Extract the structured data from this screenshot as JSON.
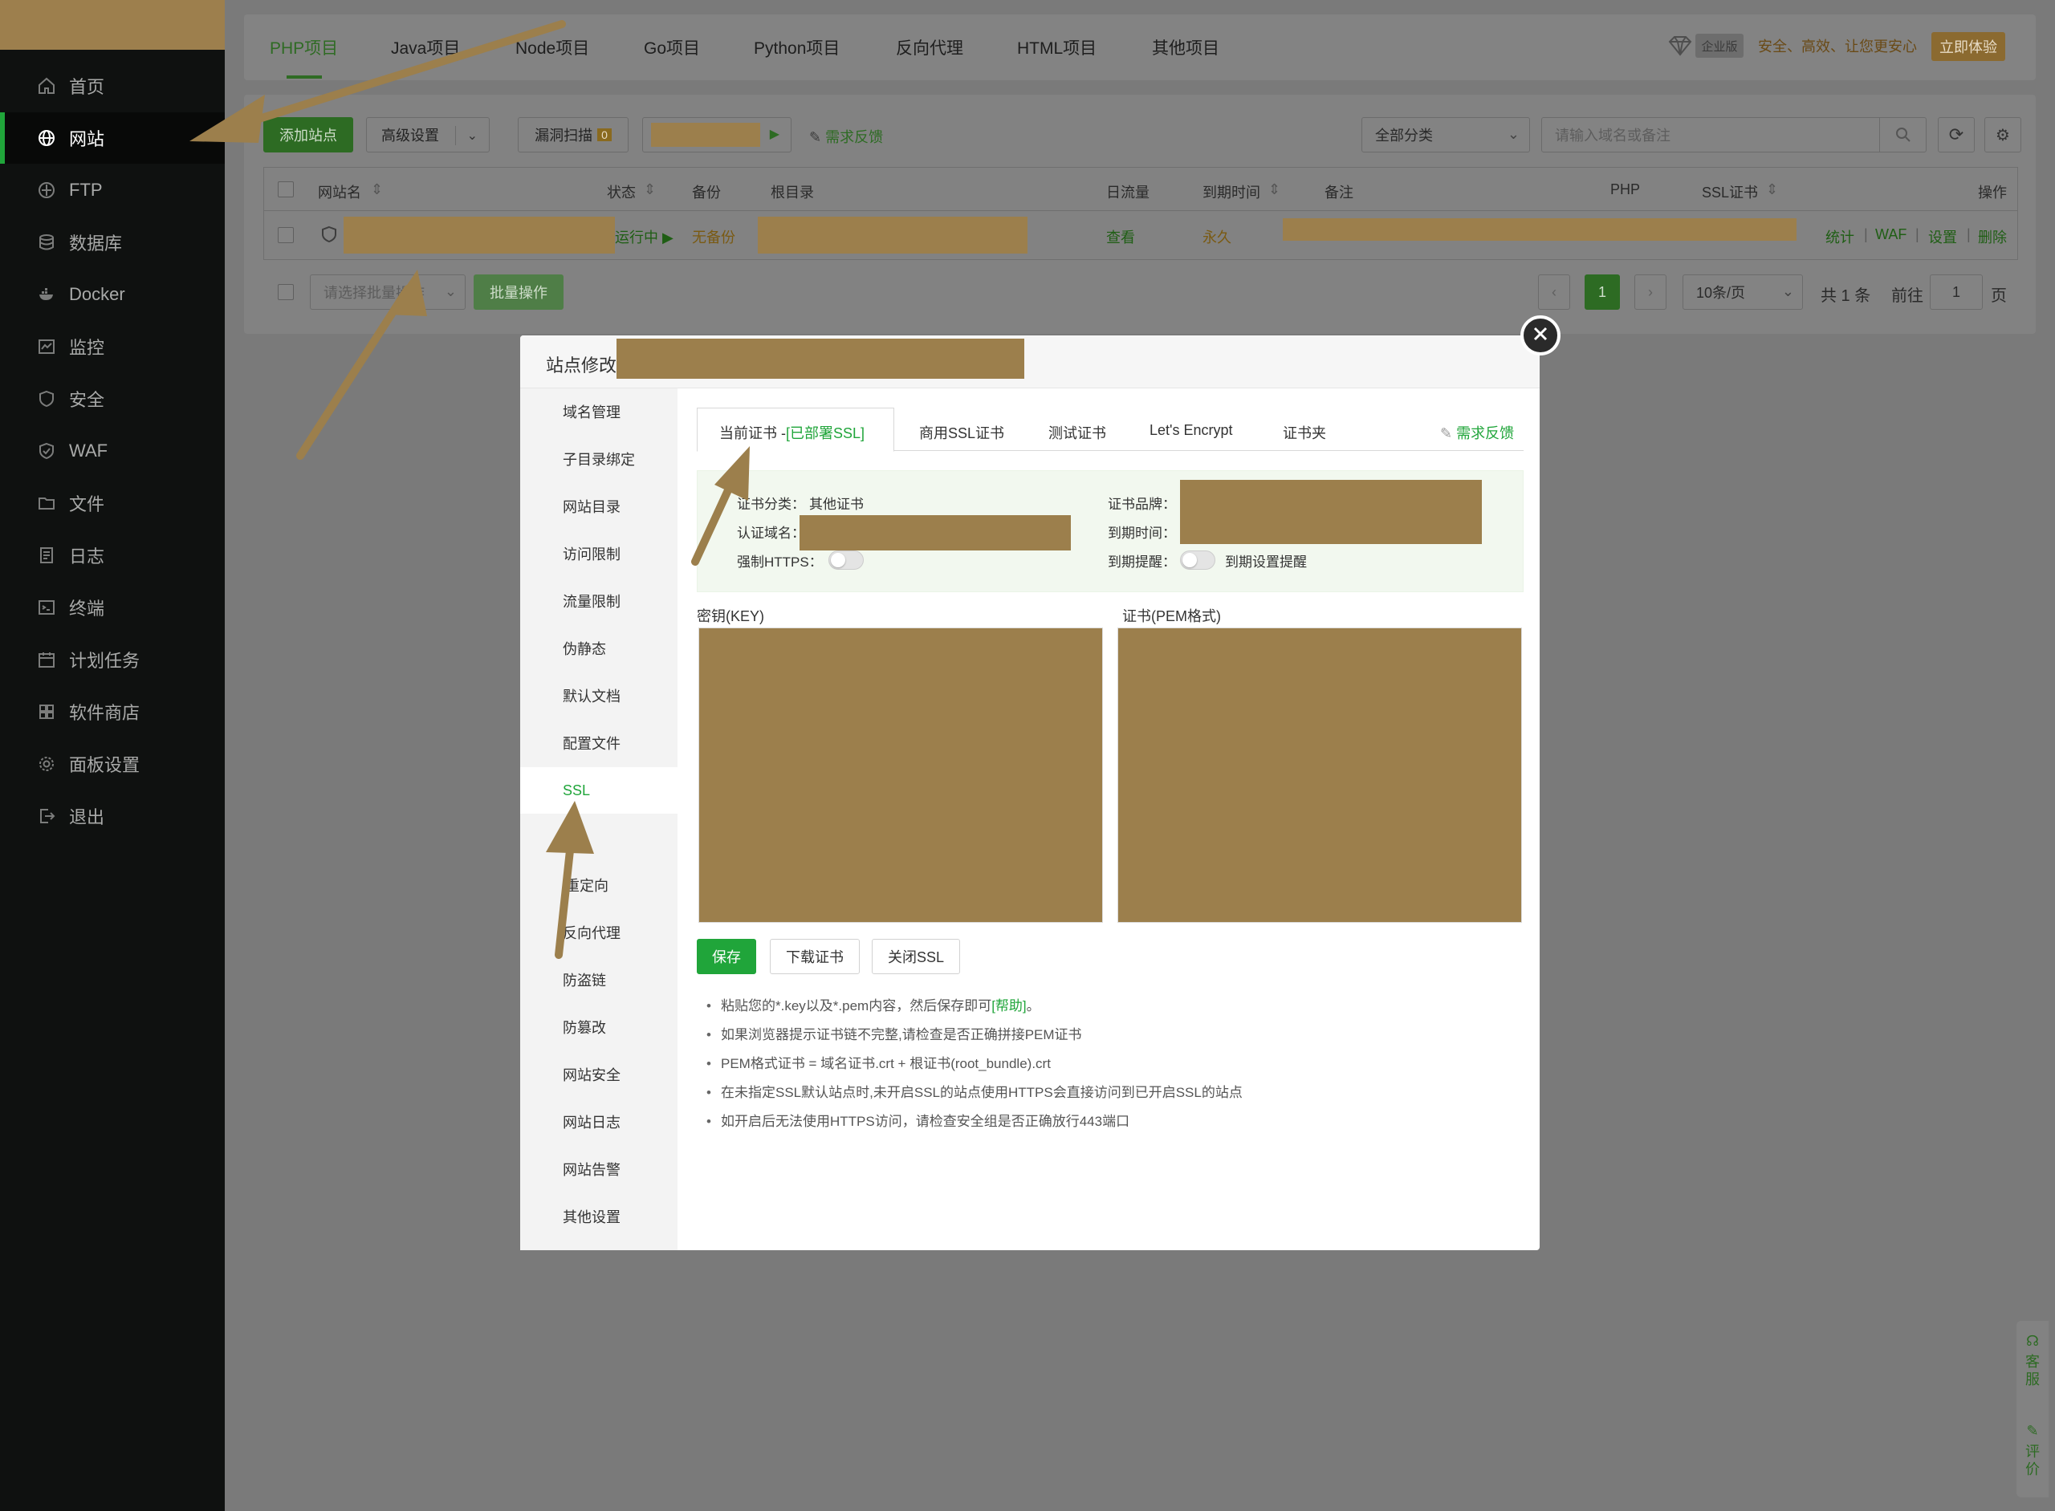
{
  "sidebar": {
    "items": [
      {
        "label": "首页",
        "icon": "home-icon"
      },
      {
        "label": "网站",
        "icon": "globe-icon"
      },
      {
        "label": "FTP",
        "icon": "ftp-icon"
      },
      {
        "label": "数据库",
        "icon": "database-icon"
      },
      {
        "label": "Docker",
        "icon": "docker-icon"
      },
      {
        "label": "监控",
        "icon": "monitor-icon"
      },
      {
        "label": "安全",
        "icon": "shield-icon"
      },
      {
        "label": "WAF",
        "icon": "waf-shield-icon"
      },
      {
        "label": "文件",
        "icon": "folder-icon"
      },
      {
        "label": "日志",
        "icon": "log-icon"
      },
      {
        "label": "终端",
        "icon": "terminal-icon"
      },
      {
        "label": "计划任务",
        "icon": "calendar-icon"
      },
      {
        "label": "软件商店",
        "icon": "apps-icon"
      },
      {
        "label": "面板设置",
        "icon": "gear-icon"
      },
      {
        "label": "退出",
        "icon": "logout-icon"
      }
    ],
    "active": "网站"
  },
  "project_tabs": [
    "PHP项目",
    "Java项目",
    "Node项目",
    "Go项目",
    "Python项目",
    "反向代理",
    "HTML项目",
    "其他项目"
  ],
  "enterprise": {
    "badge": "企业版",
    "slogan": "安全、高效、让您更安心",
    "try_label": "立即体验"
  },
  "toolbar": {
    "add_site": "添加站点",
    "advanced": "高级设置",
    "vuln_scan": "漏洞扫描",
    "vuln_count": "0",
    "feedback": "需求反馈",
    "category": "全部分类",
    "search_placeholder": "请输入域名或备注"
  },
  "table": {
    "headers": [
      "网站名",
      "状态",
      "备份",
      "根目录",
      "日流量",
      "到期时间",
      "备注",
      "PHP",
      "SSL证书",
      "操作"
    ],
    "row": {
      "status": "运行中",
      "backup": "无备份",
      "traffic": "查看",
      "expire": "永久",
      "actions": [
        "统计",
        "WAF",
        "设置",
        "删除"
      ]
    }
  },
  "footer": {
    "batch_placeholder": "请选择批量操作",
    "batch_button": "批量操作",
    "current_page": "1",
    "page_size": "10条/页",
    "total": "共 1 条",
    "goto_label": "前往",
    "goto_value": "1",
    "page_suffix": "页"
  },
  "modal": {
    "title": "站点修改[",
    "nav": [
      "域名管理",
      "子目录绑定",
      "网站目录",
      "访问限制",
      "流量限制",
      "伪静态",
      "默认文档",
      "配置文件",
      "SSL",
      "PHP",
      "重定向",
      "反向代理",
      "防盗链",
      "防篡改",
      "网站安全",
      "网站日志",
      "网站告警",
      "其他设置"
    ],
    "nav_visible": [
      "域名管理",
      "子目录绑定",
      "网站目录",
      "访问限制",
      "流量限制",
      "伪静态",
      "默认文档",
      "配置文件",
      "SSL",
      "P",
      "重定向",
      "反向代理",
      "防盗链",
      "防篡改",
      "网站安全",
      "网站日志",
      "网站告警",
      "其他设置"
    ],
    "active_nav": "SSL",
    "ssl_tabs": {
      "current": "当前证书 -",
      "current_status": "[已部署SSL]",
      "others": [
        "商用SSL证书",
        "测试证书",
        "Let's Encrypt",
        "证书夹"
      ],
      "feedback": "需求反馈"
    },
    "cert_info": {
      "category_label": "证书分类：",
      "category_value": "其他证书",
      "domain_label": "认证域名：",
      "https_label": "强制HTTPS：",
      "brand_label": "证书品牌：",
      "expire_label": "到期时间：",
      "remind_label": "到期提醒：",
      "remind_link": "到期设置提醒"
    },
    "key_label": "密钥(KEY)",
    "pem_label": "证书(PEM格式)",
    "buttons": {
      "save": "保存",
      "download": "下载证书",
      "close_ssl": "关闭SSL"
    },
    "tips": [
      {
        "text": "粘贴您的*.key以及*.pem内容，然后保存即可",
        "link": "[帮助]",
        "suffix": "。"
      },
      {
        "text": "如果浏览器提示证书链不完整,请检查是否正确拼接PEM证书"
      },
      {
        "text": "PEM格式证书 = 域名证书.crt + 根证书(root_bundle).crt"
      },
      {
        "text": "在未指定SSL默认站点时,未开启SSL的站点使用HTTPS会直接访问到已开启SSL的站点"
      },
      {
        "text": "如开启后无法使用HTTPS访问，请检查安全组是否正确放行443端口"
      }
    ]
  },
  "float": {
    "service": "客服",
    "rate": "评价"
  },
  "colors": {
    "accent_green": "#20a53a",
    "redaction": "#9c7f4c",
    "sidebar_bg": "#0f1110"
  }
}
